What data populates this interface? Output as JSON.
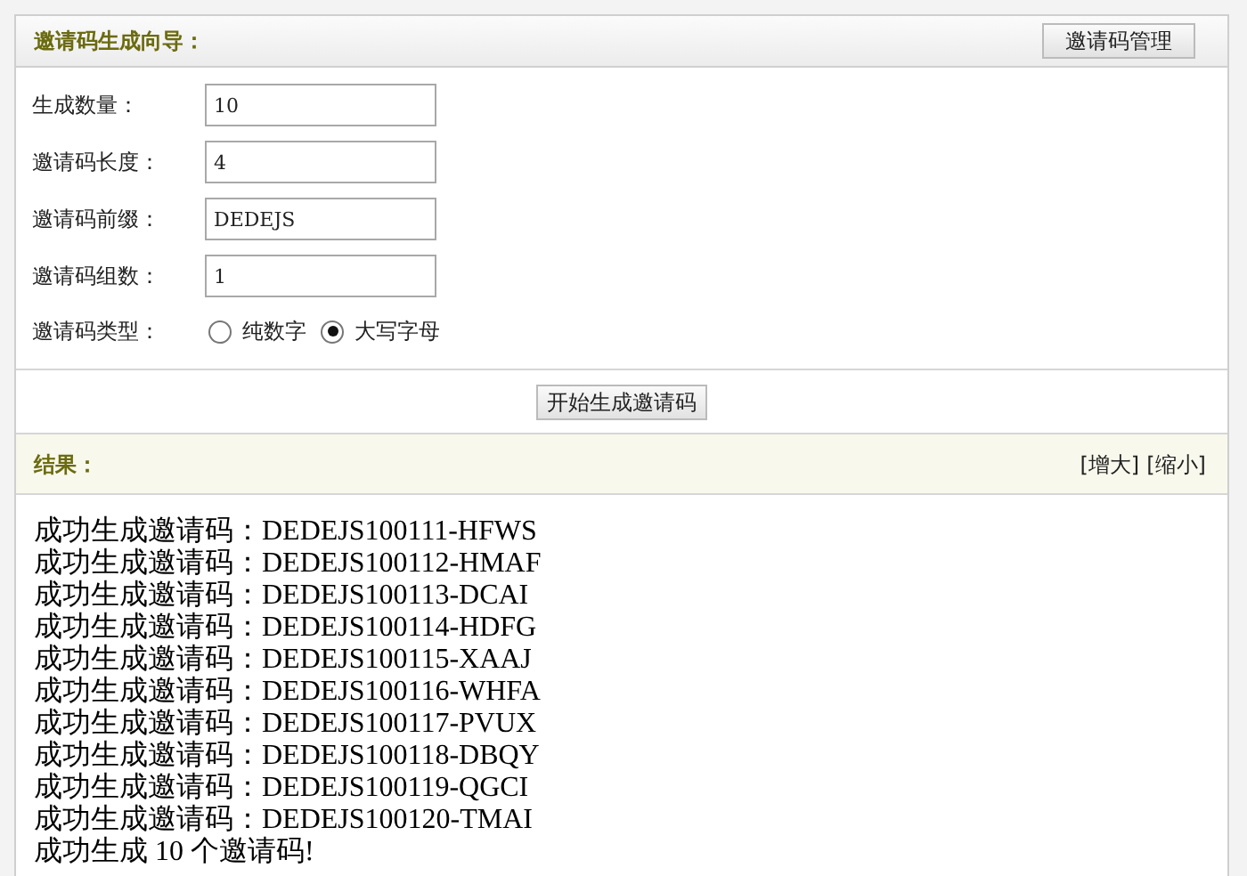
{
  "header": {
    "title": "邀请码生成向导：",
    "button": "邀请码管理"
  },
  "form": {
    "fields": [
      {
        "label": "生成数量：",
        "value": "10"
      },
      {
        "label": "邀请码长度：",
        "value": "4"
      },
      {
        "label": "邀请码前缀：",
        "value": "DEDEJS"
      },
      {
        "label": "邀请码组数：",
        "value": "1"
      }
    ],
    "type": {
      "label": "邀请码类型：",
      "options": [
        {
          "label": "纯数字",
          "selected": false
        },
        {
          "label": "大写字母",
          "selected": true
        }
      ]
    },
    "submit": "开始生成邀请码"
  },
  "results": {
    "title": "结果：",
    "links": [
      "[增大]",
      "[缩小]"
    ],
    "lines": [
      "成功生成邀请码：DEDEJS100111-HFWS",
      "成功生成邀请码：DEDEJS100112-HMAF",
      "成功生成邀请码：DEDEJS100113-DCAI",
      "成功生成邀请码：DEDEJS100114-HDFG",
      "成功生成邀请码：DEDEJS100115-XAAJ",
      "成功生成邀请码：DEDEJS100116-WHFA",
      "成功生成邀请码：DEDEJS100117-PVUX",
      "成功生成邀请码：DEDEJS100118-DBQY",
      "成功生成邀请码：DEDEJS100119-QGCI",
      "成功生成邀请码：DEDEJS100120-TMAI",
      "成功生成 10 个邀请码!"
    ]
  }
}
